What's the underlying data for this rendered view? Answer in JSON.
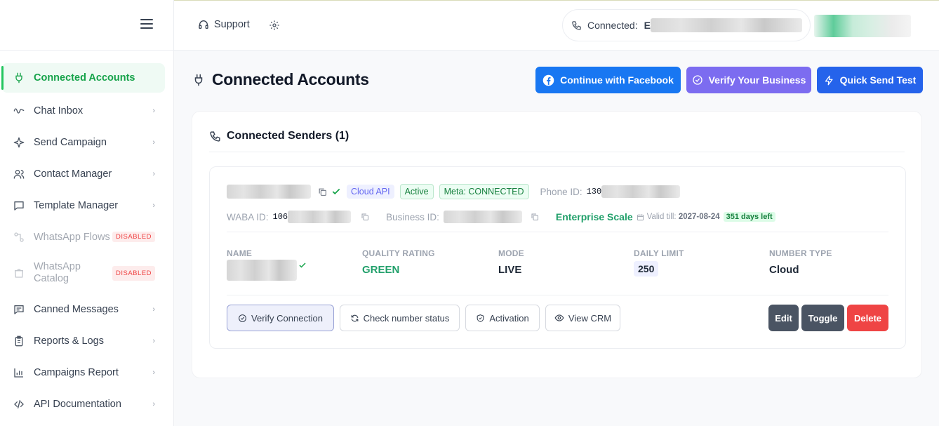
{
  "sidebar": {
    "items": [
      {
        "label": "Connected Accounts",
        "icon": "plug-icon"
      },
      {
        "label": "Chat Inbox",
        "icon": "chat-wave-icon"
      },
      {
        "label": "Send Campaign",
        "icon": "sparkle-icon"
      },
      {
        "label": "Contact Manager",
        "icon": "users-icon"
      },
      {
        "label": "Template Manager",
        "icon": "message-square-icon"
      },
      {
        "label": "WhatsApp Flows",
        "icon": "flows-icon",
        "badge": "DISABLED"
      },
      {
        "label": "WhatsApp Catalog",
        "icon": "bag-icon",
        "badge": "DISABLED"
      },
      {
        "label": "Canned Messages",
        "icon": "message-lines-icon"
      },
      {
        "label": "Reports & Logs",
        "icon": "clipboard-icon"
      },
      {
        "label": "Campaigns Report",
        "icon": "bar-chart-icon"
      },
      {
        "label": "API Documentation",
        "icon": "code-icon"
      }
    ]
  },
  "topbar": {
    "support_label": "Support",
    "connected_label": "Connected:",
    "connected_value_initial": "E"
  },
  "header": {
    "title": "Connected Accounts",
    "buttons": {
      "facebook": "Continue with Facebook",
      "verify_business": "Verify Your Business",
      "quick_send": "Quick Send Test"
    }
  },
  "card": {
    "title": "Connected Senders (1)",
    "sender": {
      "tags": {
        "cloud": "Cloud API",
        "status": "Active",
        "meta": "Meta: CONNECTED"
      },
      "phone_id_label": "Phone ID:",
      "phone_id_prefix": "130",
      "waba_id_label": "WABA ID:",
      "waba_id_prefix": "106",
      "business_id_label": "Business ID:",
      "plan": "Enterprise Scale",
      "valid_till_label": "Valid till:",
      "valid_till_date": "2027-08-24",
      "days_left": "351 days left",
      "stats": {
        "name_label": "NAME",
        "quality_label": "QUALITY RATING",
        "quality_value": "GREEN",
        "mode_label": "MODE",
        "mode_value": "LIVE",
        "limit_label": "DAILY LIMIT",
        "limit_value": "250",
        "type_label": "NUMBER TYPE",
        "type_value": "Cloud"
      },
      "actions": {
        "verify": "Verify Connection",
        "check": "Check number status",
        "activation": "Activation",
        "crm": "View CRM",
        "edit": "Edit",
        "toggle": "Toggle",
        "delete": "Delete"
      }
    }
  },
  "colors": {
    "accent_green": "#22c55e",
    "facebook_blue": "#1877f2",
    "verify_purple": "#7c6cf0",
    "quick_blue": "#2563eb",
    "delete_red": "#ef4444"
  }
}
